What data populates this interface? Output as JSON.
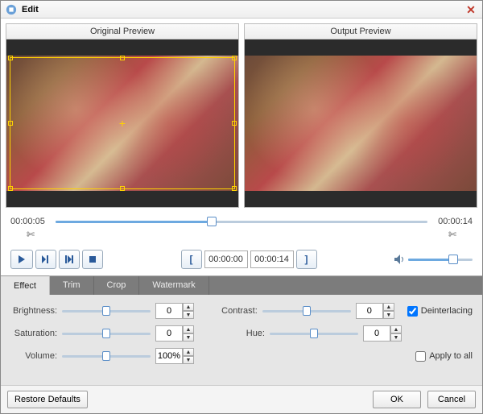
{
  "title": "Edit",
  "previews": {
    "original": "Original Preview",
    "output": "Output Preview"
  },
  "timeline": {
    "start": "00:00:05",
    "end": "00:00:14",
    "progress_pct": 42
  },
  "range": {
    "in": "00:00:00",
    "out": "00:00:14"
  },
  "tabs": {
    "effect": "Effect",
    "trim": "Trim",
    "crop": "Crop",
    "watermark": "Watermark"
  },
  "props": {
    "brightness": {
      "label": "Brightness:",
      "value": "0",
      "pos": 50
    },
    "saturation": {
      "label": "Saturation:",
      "value": "0",
      "pos": 50
    },
    "volume": {
      "label": "Volume:",
      "value": "100%",
      "pos": 50
    },
    "contrast": {
      "label": "Contrast:",
      "value": "0",
      "pos": 50
    },
    "hue": {
      "label": "Hue:",
      "value": "0",
      "pos": 50
    }
  },
  "checks": {
    "deinterlacing": "Deinterlacing",
    "apply_all": "Apply to all"
  },
  "buttons": {
    "restore": "Restore Defaults",
    "ok": "OK",
    "cancel": "Cancel"
  },
  "volume_slider_pct": 70
}
